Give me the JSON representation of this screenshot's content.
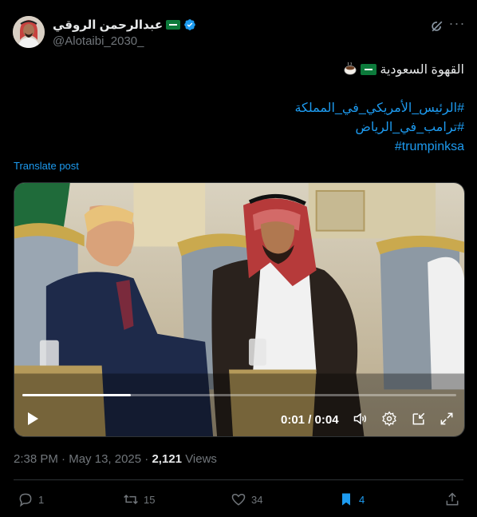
{
  "user": {
    "display_name": "عبدالرحمن الروقي",
    "handle": "@Alotaibi_2030_",
    "flag_icon": "saudi-flag",
    "verified_icon": "verified-badge"
  },
  "post": {
    "line1_text": "القهوة السعودية",
    "hashtags": [
      "#الرئيس_الأمريكي_في_المملكة",
      "#ترامب_في_الرياض",
      "#trumpinksa"
    ],
    "translate_label": "Translate post"
  },
  "video": {
    "time_display": "0:01 / 0:04",
    "progress": 0.25
  },
  "meta": {
    "time": "2:38 PM",
    "separator1": "·",
    "date": "May 13, 2025",
    "separator2": "·",
    "views_count": "2,121",
    "views_label": "Views"
  },
  "actions": {
    "replies": "1",
    "reposts": "15",
    "likes": "34",
    "bookmarks": "4"
  },
  "colors": {
    "accent": "#1d9bf0",
    "muted": "#71767b",
    "background": "#000000"
  }
}
